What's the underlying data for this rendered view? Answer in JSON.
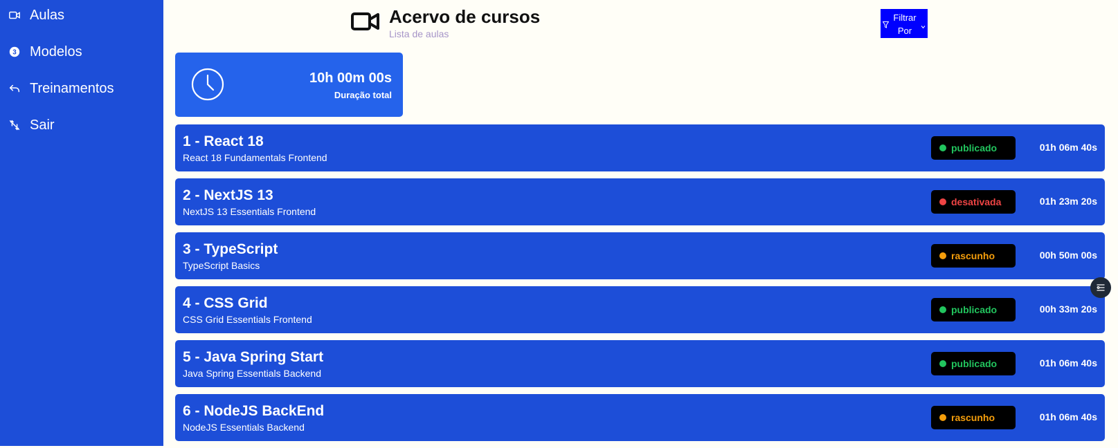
{
  "sidebar": {
    "items": [
      {
        "label": "Aulas",
        "icon": "video-icon"
      },
      {
        "label": "Modelos",
        "icon": "number-circle-icon"
      },
      {
        "label": "Treinamentos",
        "icon": "undo-arrow-icon"
      },
      {
        "label": "Sair",
        "icon": "crossed-arrows-icon"
      }
    ],
    "background": "#1d4ed8"
  },
  "header": {
    "icon": "video-camera-icon",
    "title": "Acervo de cursos",
    "subtitle": "Lista de aulas"
  },
  "filter": {
    "label": "Filtrar Por",
    "icon": "filter-icon",
    "background": "#0000ff"
  },
  "total": {
    "value": "10h 00m 00s",
    "label": "Duração total",
    "icon": "clock-icon"
  },
  "courses": [
    {
      "title": "1 - React 18",
      "description": "React 18 Fundamentals Frontend",
      "status": "publicado",
      "status_color": "#22c55e",
      "duration": "01h 06m 40s"
    },
    {
      "title": "2 - NextJS 13",
      "description": "NextJS 13 Essentials Frontend",
      "status": "desativada",
      "status_color": "#ef4444",
      "duration": "01h 23m 20s"
    },
    {
      "title": "3 - TypeScript",
      "description": "TypeScript Basics",
      "status": "rascunho",
      "status_color": "#f59e0b",
      "duration": "00h 50m 00s"
    },
    {
      "title": "4 - CSS Grid",
      "description": "CSS Grid Essentials Frontend",
      "status": "publicado",
      "status_color": "#22c55e",
      "duration": "00h 33m 20s"
    },
    {
      "title": "5 - Java Spring Start",
      "description": "Java Spring Essentials Backend",
      "status": "publicado",
      "status_color": "#22c55e",
      "duration": "01h 06m 40s"
    },
    {
      "title": "6 - NodeJS BackEnd",
      "description": "NodeJS Essentials Backend",
      "status": "rascunho",
      "status_color": "#f59e0b",
      "duration": "01h 06m 40s"
    }
  ],
  "floating_button": {
    "icon": "settings-list-icon"
  }
}
